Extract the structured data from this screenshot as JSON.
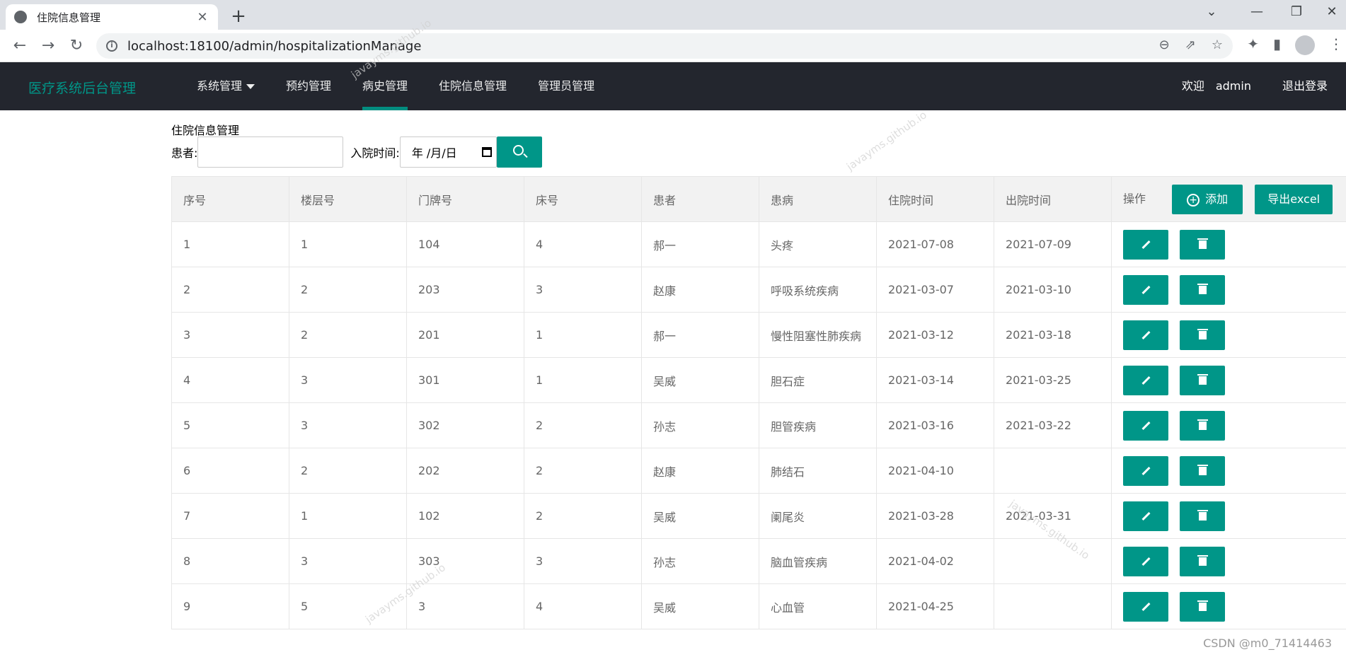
{
  "browser": {
    "tab_title": "住院信息管理",
    "tab_close": "✕",
    "new_tab": "+",
    "url": "localhost:18100/admin/hospitalizationManage",
    "controls": {
      "minimize": "—",
      "restore": "❐",
      "close": "✕",
      "tab_list": "⌄"
    },
    "nav": {
      "back": "←",
      "forward": "→",
      "reload": "↻"
    },
    "omnibox_icons": {
      "zoom": "⊖",
      "share": "⇗",
      "bookmark": "☆"
    },
    "toolbar_icons": {
      "extensions": "✦",
      "sidepanel": "▮",
      "menu": "⋮"
    }
  },
  "header": {
    "logo": "医疗系统后台管理",
    "nav": [
      {
        "label": "系统管理",
        "dropdown": true
      },
      {
        "label": "预约管理"
      },
      {
        "label": "病史管理",
        "active": true
      },
      {
        "label": "住院信息管理"
      },
      {
        "label": "管理员管理"
      }
    ],
    "welcome": "欢迎",
    "username": "admin",
    "logout": "退出登录"
  },
  "page": {
    "heading": "住院信息管理",
    "patient_label": "患者:",
    "admission_label": "入院时间:",
    "date_placeholder": "年 /月/日"
  },
  "table": {
    "headers": [
      "序号",
      "楼层号",
      "门牌号",
      "床号",
      "患者",
      "患病",
      "住院时间",
      "出院时间",
      "操作"
    ],
    "add_label": "添加",
    "add_icon": "+",
    "export_label": "导出excel",
    "rows": [
      [
        "1",
        "1",
        "104",
        "4",
        "郝一",
        "头疼",
        "2021-07-08",
        "2021-07-09"
      ],
      [
        "2",
        "2",
        "203",
        "3",
        "赵康",
        "呼吸系统疾病",
        "2021-03-07",
        "2021-03-10"
      ],
      [
        "3",
        "2",
        "201",
        "1",
        "郝一",
        "慢性阻塞性肺疾病",
        "2021-03-12",
        "2021-03-18"
      ],
      [
        "4",
        "3",
        "301",
        "1",
        "吴威",
        "胆石症",
        "2021-03-14",
        "2021-03-25"
      ],
      [
        "5",
        "3",
        "302",
        "2",
        "孙志",
        "胆管疾病",
        "2021-03-16",
        "2021-03-22"
      ],
      [
        "6",
        "2",
        "202",
        "2",
        "赵康",
        "肺结石",
        "2021-04-10",
        ""
      ],
      [
        "7",
        "1",
        "102",
        "2",
        "吴威",
        "阑尾炎",
        "2021-03-28",
        "2021-03-31"
      ],
      [
        "8",
        "3",
        "303",
        "3",
        "孙志",
        "脑血管疾病",
        "2021-04-02",
        ""
      ],
      [
        "9",
        "5",
        "3",
        "4",
        "吴威",
        "心血管",
        "2021-04-25",
        ""
      ]
    ]
  },
  "watermark": "javayms.github.io",
  "footer": "CSDN @m0_71414463"
}
